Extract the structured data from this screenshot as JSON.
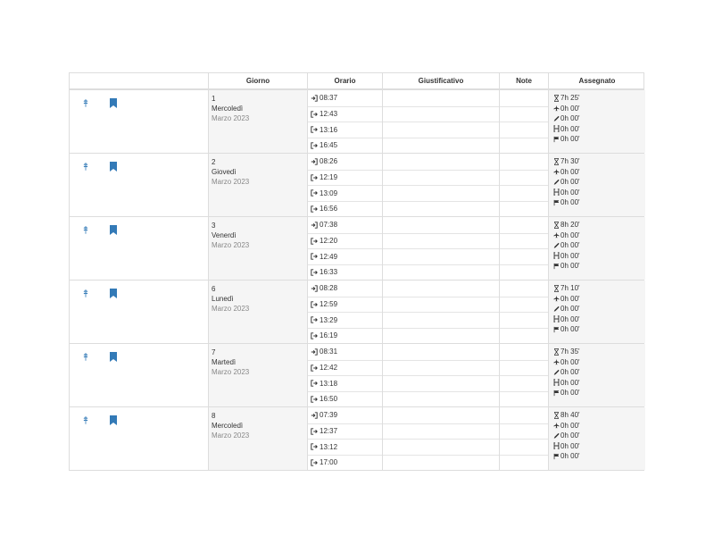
{
  "headers": [
    "",
    "Giorno",
    "Orario",
    "Giustificativo",
    "Note",
    "Assegnato"
  ],
  "colors": {
    "accent": "#337ab7",
    "border": "#dddddd",
    "shade": "#f5f5f5"
  },
  "icons": {
    "row_action_1": "wheat-icon",
    "row_action_2": "bookmark-icon",
    "punch_in": "sign-in-icon",
    "punch_out": "sign-out-icon",
    "work": "hourglass-icon",
    "travel": "plane-icon",
    "leave": "pencil-icon",
    "holiday": "hotel-icon",
    "flag": "flag-icon"
  },
  "days": [
    {
      "num": "1",
      "name": "Mercoledì",
      "month": "Marzo 2023",
      "punches": [
        {
          "dir": "in",
          "time": "08:37"
        },
        {
          "dir": "out",
          "time": "12:43"
        },
        {
          "dir": "out",
          "time": "13:16"
        },
        {
          "dir": "out",
          "time": "16:45"
        }
      ],
      "assigned": [
        "7h 25'",
        "0h 00'",
        "0h 00'",
        "0h 00'",
        "0h 00'"
      ]
    },
    {
      "num": "2",
      "name": "Giovedì",
      "month": "Marzo 2023",
      "punches": [
        {
          "dir": "in",
          "time": "08:26"
        },
        {
          "dir": "out",
          "time": "12:19"
        },
        {
          "dir": "out",
          "time": "13:09"
        },
        {
          "dir": "out",
          "time": "16:56"
        }
      ],
      "assigned": [
        "7h 30'",
        "0h 00'",
        "0h 00'",
        "0h 00'",
        "0h 00'"
      ]
    },
    {
      "num": "3",
      "name": "Venerdì",
      "month": "Marzo 2023",
      "punches": [
        {
          "dir": "in",
          "time": "07:38"
        },
        {
          "dir": "out",
          "time": "12:20"
        },
        {
          "dir": "out",
          "time": "12:49"
        },
        {
          "dir": "out",
          "time": "16:33"
        }
      ],
      "assigned": [
        "8h 20'",
        "0h 00'",
        "0h 00'",
        "0h 00'",
        "0h 00'"
      ]
    },
    {
      "num": "6",
      "name": "Lunedì",
      "month": "Marzo 2023",
      "punches": [
        {
          "dir": "in",
          "time": "08:28"
        },
        {
          "dir": "out",
          "time": "12:59"
        },
        {
          "dir": "out",
          "time": "13:29"
        },
        {
          "dir": "out",
          "time": "16:19"
        }
      ],
      "assigned": [
        "7h 10'",
        "0h 00'",
        "0h 00'",
        "0h 00'",
        "0h 00'"
      ]
    },
    {
      "num": "7",
      "name": "Martedì",
      "month": "Marzo 2023",
      "punches": [
        {
          "dir": "in",
          "time": "08:31"
        },
        {
          "dir": "out",
          "time": "12:42"
        },
        {
          "dir": "out",
          "time": "13:18"
        },
        {
          "dir": "out",
          "time": "16:50"
        }
      ],
      "assigned": [
        "7h 35'",
        "0h 00'",
        "0h 00'",
        "0h 00'",
        "0h 00'"
      ]
    },
    {
      "num": "8",
      "name": "Mercoledì",
      "month": "Marzo 2023",
      "punches": [
        {
          "dir": "in",
          "time": "07:39"
        },
        {
          "dir": "out",
          "time": "12:37"
        },
        {
          "dir": "out",
          "time": "13:12"
        },
        {
          "dir": "out",
          "time": "17:00"
        }
      ],
      "assigned": [
        "8h 40'",
        "0h 00'",
        "0h 00'",
        "0h 00'",
        "0h 00'"
      ]
    }
  ]
}
